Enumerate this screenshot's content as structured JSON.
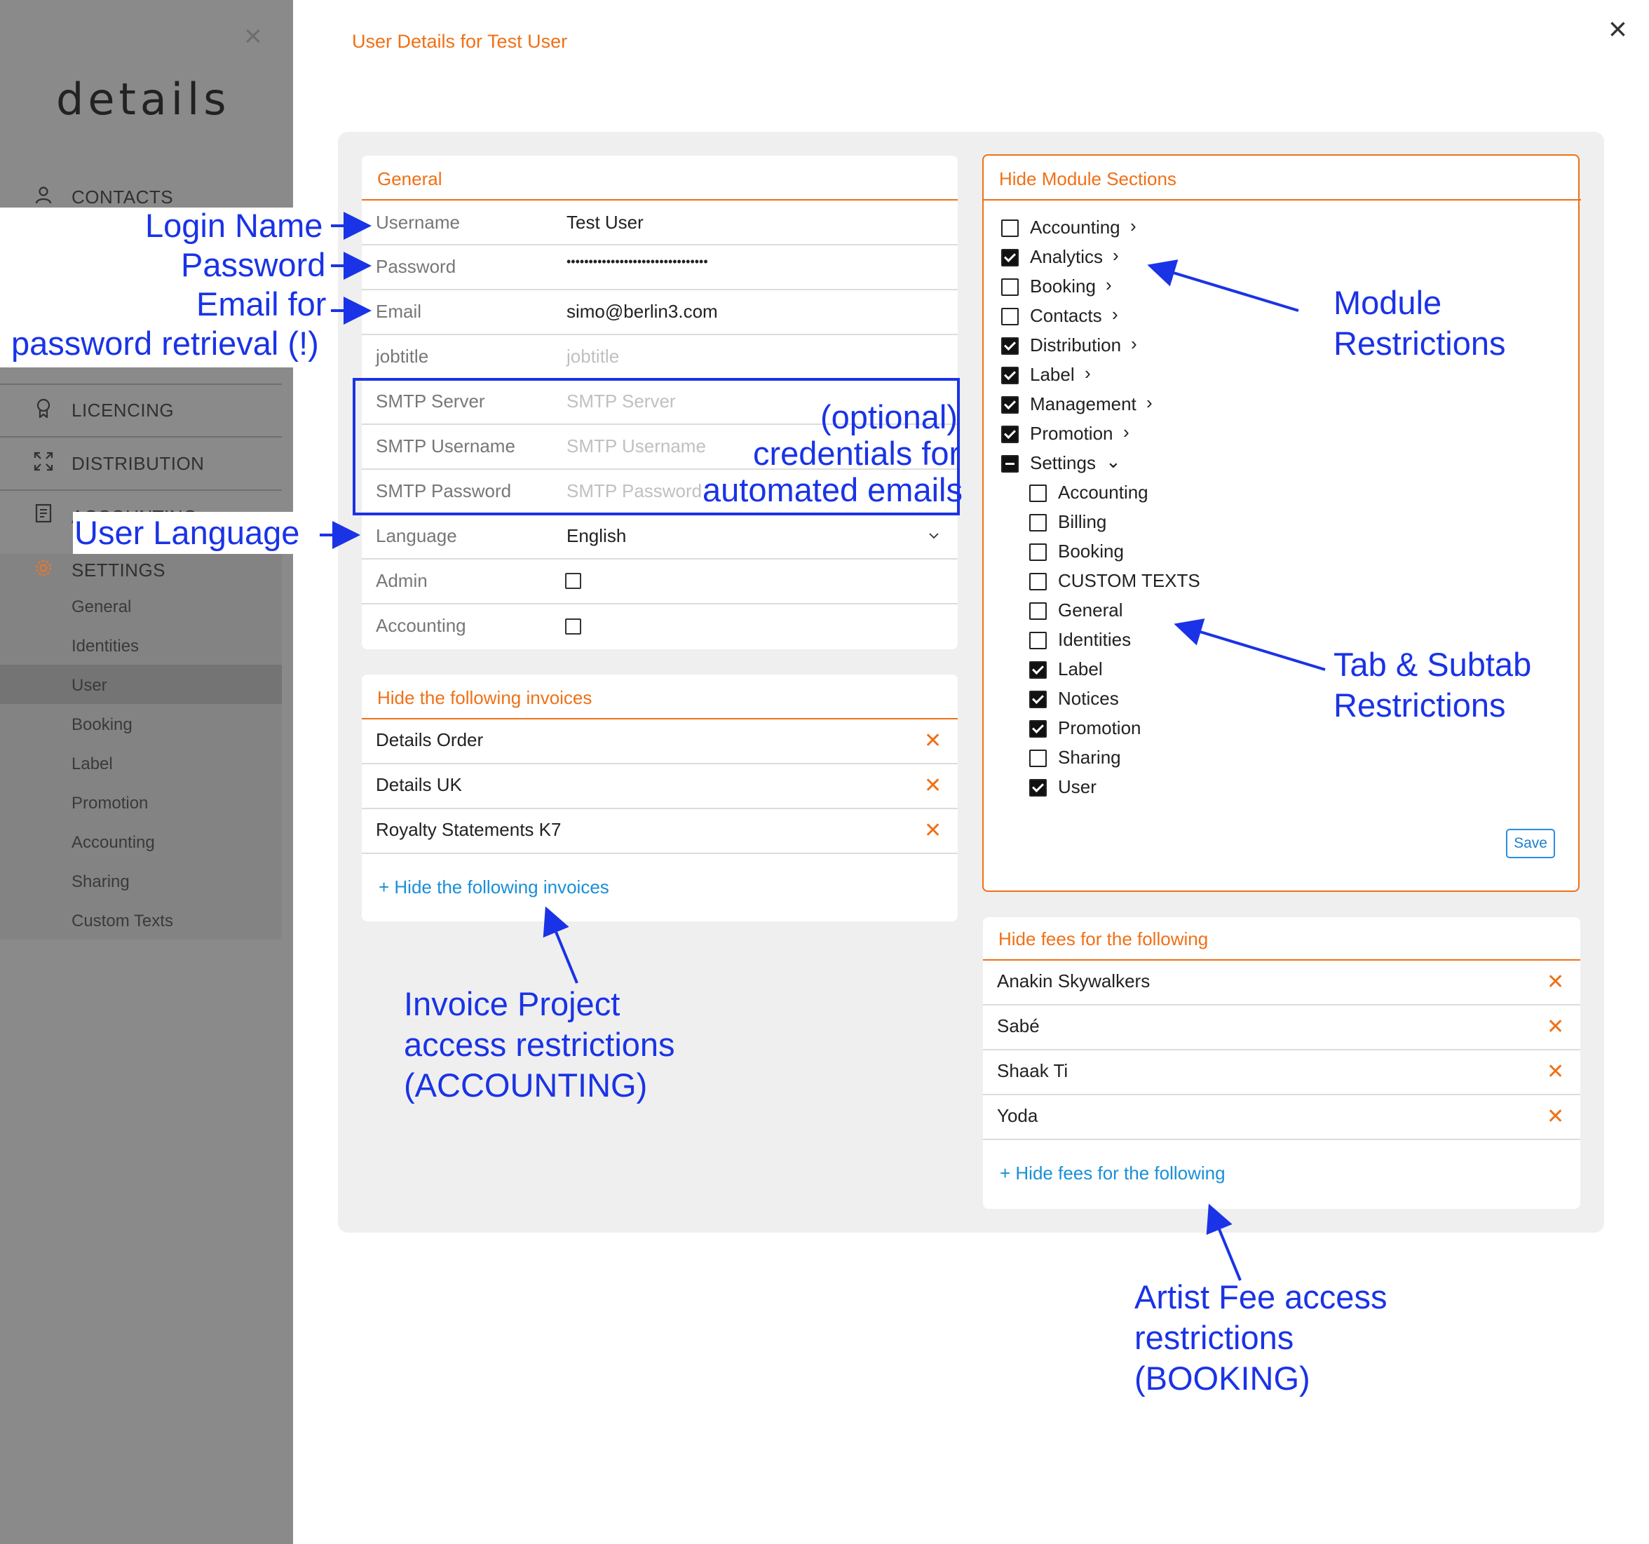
{
  "sidebar": {
    "logo": "details",
    "close": "×",
    "nav": [
      {
        "label": "CONTACTS",
        "icon": "person-icon"
      },
      {
        "label": "LICENCING",
        "icon": "ribbon-icon"
      },
      {
        "label": "DISTRIBUTION",
        "icon": "expand-icon"
      },
      {
        "label": "ACCOUNTING",
        "icon": "document-icon"
      },
      {
        "label": "SETTINGS",
        "icon": "gear-icon"
      }
    ],
    "settings_items": [
      "General",
      "Identities",
      "User",
      "Booking",
      "Label",
      "Promotion",
      "Accounting",
      "Sharing",
      "Custom Texts"
    ],
    "active_item": "User"
  },
  "page": {
    "title": "User Details for Test User",
    "close": "×"
  },
  "general": {
    "title": "General",
    "username_label": "Username",
    "username_value": "Test User",
    "password_label": "Password",
    "password_value": "••••••••••••••••••••••••••••••••",
    "email_label": "Email",
    "email_value": "simo@berlin3.com",
    "jobtitle_label": "jobtitle",
    "jobtitle_placeholder": "jobtitle",
    "smtp_server_label": "SMTP Server",
    "smtp_server_placeholder": "SMTP Server",
    "smtp_username_label": "SMTP Username",
    "smtp_username_placeholder": "SMTP Username",
    "smtp_password_label": "SMTP Password",
    "smtp_password_placeholder": "SMTP Password",
    "language_label": "Language",
    "language_value": "English",
    "admin_label": "Admin",
    "admin_checked": false,
    "accounting_label": "Accounting",
    "accounting_checked": false
  },
  "invoices": {
    "title": "Hide the following invoices",
    "items": [
      "Details Order",
      "Details UK",
      "Royalty Statements K7"
    ],
    "add_link": "+ Hide the following invoices"
  },
  "modules": {
    "title": "Hide Module Sections",
    "items": [
      {
        "label": "Accounting",
        "state": "off",
        "chevron": "›"
      },
      {
        "label": "Analytics",
        "state": "on",
        "chevron": "›"
      },
      {
        "label": "Booking",
        "state": "off",
        "chevron": "›"
      },
      {
        "label": "Contacts",
        "state": "off",
        "chevron": "›"
      },
      {
        "label": "Distribution",
        "state": "on",
        "chevron": "›"
      },
      {
        "label": "Label",
        "state": "on",
        "chevron": "›"
      },
      {
        "label": "Management",
        "state": "on",
        "chevron": "›"
      },
      {
        "label": "Promotion",
        "state": "on",
        "chevron": "›"
      },
      {
        "label": "Settings",
        "state": "indeterminate",
        "chevron": "⌄"
      }
    ],
    "settings_children": [
      {
        "label": "Accounting",
        "state": "off"
      },
      {
        "label": "Billing",
        "state": "off"
      },
      {
        "label": "Booking",
        "state": "off"
      },
      {
        "label": "CUSTOM TEXTS",
        "state": "off"
      },
      {
        "label": "General",
        "state": "off"
      },
      {
        "label": "Identities",
        "state": "off"
      },
      {
        "label": "Label",
        "state": "on"
      },
      {
        "label": "Notices",
        "state": "on"
      },
      {
        "label": "Promotion",
        "state": "on"
      },
      {
        "label": "Sharing",
        "state": "off"
      },
      {
        "label": "User",
        "state": "on"
      }
    ],
    "save_label": "Save"
  },
  "fees": {
    "title": "Hide fees for the following",
    "items": [
      "Anakin Skywalkers",
      "Sabé",
      "Shaak Ti",
      "Yoda"
    ],
    "add_link": "+ Hide fees for the following"
  },
  "annotations": {
    "login_name": "Login Name",
    "password": "Password",
    "email_line1": "Email for",
    "email_line2": "password retrieval (!)",
    "smtp_line1": "(optional)",
    "smtp_line2": "credentials for",
    "smtp_line3": "automated emails",
    "user_language": "User Language",
    "module_line1": "Module",
    "module_line2": "Restrictions",
    "tab_line1": "Tab & Subtab",
    "tab_line2": "Restrictions",
    "invoice_line1": "Invoice Project",
    "invoice_line2": "access restrictions",
    "invoice_line3": "(ACCOUNTING)",
    "artist_line1": "Artist Fee access",
    "artist_line2": "restrictions",
    "artist_line3": "(BOOKING)",
    "color": "#1a33e6"
  },
  "colors": {
    "accent": "#f07016",
    "link": "#1a8fd8",
    "annotation": "#1a33e6"
  }
}
